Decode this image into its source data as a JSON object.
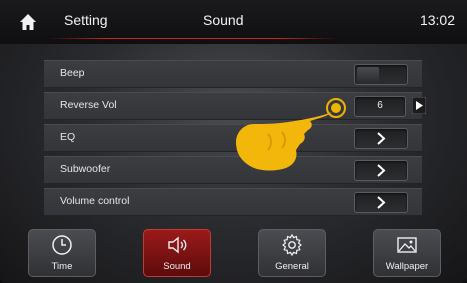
{
  "header": {
    "left_title": "Setting",
    "center_title": "Sound",
    "clock": "13:02",
    "accent_color": "#c8281e"
  },
  "settings": {
    "rows": [
      {
        "label": "Beep",
        "control": "toggle"
      },
      {
        "label": "Reverse Vol",
        "control": "stepper",
        "value": "6"
      },
      {
        "label": "EQ",
        "control": "chevron-right-icon"
      },
      {
        "label": "Subwoofer",
        "control": "chevron-right-icon"
      },
      {
        "label": "Volume control",
        "control": "chevron-right-icon"
      }
    ]
  },
  "tabs": [
    {
      "label": "Time",
      "icon": "clock-icon",
      "active": false
    },
    {
      "label": "Sound",
      "icon": "speaker-icon",
      "active": true
    },
    {
      "label": "General",
      "icon": "gear-icon",
      "active": false
    },
    {
      "label": "Wallpaper",
      "icon": "image-icon",
      "active": false
    }
  ],
  "colors": {
    "active_tab": "#9b1a1a",
    "tap_hint": "#f0b400"
  }
}
